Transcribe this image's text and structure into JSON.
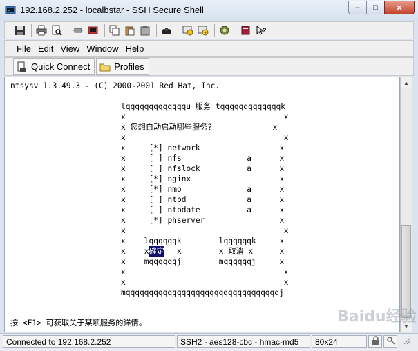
{
  "window": {
    "title": "192.168.2.252 - localbstar - SSH Secure Shell"
  },
  "window_buttons": {
    "minimize": "–",
    "maximize": "□",
    "close": "✕"
  },
  "menu": [
    "File",
    "Edit",
    "View",
    "Window",
    "Help"
  ],
  "quickbar": {
    "quick_connect": "Quick Connect",
    "profiles": "Profiles"
  },
  "terminal": {
    "header": "ntsysv 1.3.49.3 - (C) 2000-2001 Red Hat, Inc.",
    "dialog": {
      "top": "lqqqqqqqqqqqqqu 服务 tqqqqqqqqqqqqqk",
      "question": "x 您想自动启动哪些服务?             x",
      "blank": "x                                  x",
      "bottom": "mqqqqqqqqqqqqqqqqqqqqqqqqqqqqqqqqqj",
      "services": [
        {
          "mark": "[*]",
          "name": "network",
          "flag": " "
        },
        {
          "mark": "[ ]",
          "name": "nfs",
          "flag": "a"
        },
        {
          "mark": "[ ]",
          "name": "nfslock",
          "flag": "a"
        },
        {
          "mark": "[*]",
          "name": "nginx",
          "flag": " "
        },
        {
          "mark": "[*]",
          "name": "nmo",
          "flag": "a"
        },
        {
          "mark": "[ ]",
          "name": "ntpd",
          "flag": "a"
        },
        {
          "mark": "[ ]",
          "name": "ntpdate",
          "flag": "a"
        },
        {
          "mark": "[*]",
          "name": "phserver",
          "flag": " "
        }
      ],
      "ok_button": {
        "top": "lqqqqqqk",
        "label": "確定",
        "bottom": "mqqqqqqj"
      },
      "cancel_button": {
        "top": "lqqqqqqk",
        "label": "x 取消 x",
        "bottom": "mqqqqqqj"
      }
    },
    "footer": "按 <F1> 可获取关于某项服务的详情。"
  },
  "status": {
    "connection": "Connected to 192.168.2.252",
    "cipher": "SSH2 - aes128-cbc - hmac-md5",
    "size": "80x24"
  },
  "watermark": "Baidu经验",
  "colors": {
    "selection": "#10106e",
    "terminal_bg": "#ffffff"
  }
}
